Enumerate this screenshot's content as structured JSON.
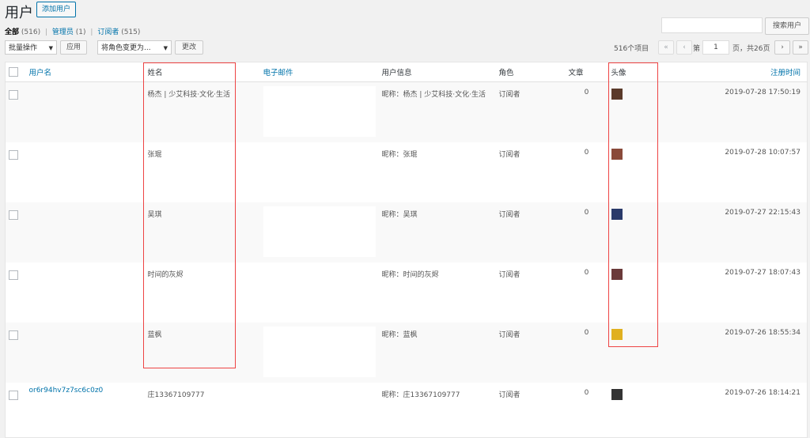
{
  "header": {
    "title": "用户",
    "add_button": "添加用户"
  },
  "search": {
    "button": "搜索用户",
    "value": ""
  },
  "filters": [
    {
      "label": "全部",
      "count": "(516)"
    },
    {
      "label": "管理员",
      "count": "(1)"
    },
    {
      "label": "订阅者",
      "count": "(515)"
    }
  ],
  "toolbar": {
    "bulk_select": "批量操作",
    "apply": "应用",
    "role_select": "将角色变更为...",
    "change": "更改"
  },
  "pagination": {
    "items": "516个项目",
    "first": "«",
    "prev": "‹",
    "prefix": "第",
    "current": "1",
    "suffix": "页，共26页",
    "next": "›",
    "last": "»"
  },
  "columns": {
    "username": "用户名",
    "name": "姓名",
    "email": "电子邮件",
    "info": "用户信息",
    "role": "角色",
    "posts": "文章",
    "avatar": "头像",
    "registered": "注册时间"
  },
  "rows": [
    {
      "username": "",
      "name": "杨杰 | 少艾科技·文化·生活",
      "email": "",
      "info": "昵称：杨杰 | 少艾科技·文化·生活",
      "role": "订阅者",
      "posts": "0",
      "avatar_color": "#5a3a2a",
      "registered": "2019-07-28 17:50:19"
    },
    {
      "username": "",
      "name": "张琨",
      "email": "",
      "info": "昵称：张琨",
      "role": "订阅者",
      "posts": "0",
      "avatar_color": "#8a4a3a",
      "registered": "2019-07-28 10:07:57"
    },
    {
      "username": "",
      "name": "吴琪",
      "email": "",
      "info": "昵称：吴琪",
      "role": "订阅者",
      "posts": "0",
      "avatar_color": "#2a3a6a",
      "registered": "2019-07-27 22:15:43"
    },
    {
      "username": "",
      "name": "时间的灰烬",
      "email": "",
      "info": "昵称：时间的灰烬",
      "role": "订阅者",
      "posts": "0",
      "avatar_color": "#6a3a3a",
      "registered": "2019-07-27 18:07:43"
    },
    {
      "username": "",
      "name": "蓝枫",
      "email": "",
      "info": "昵称：蓝枫",
      "role": "订阅者",
      "posts": "0",
      "avatar_color": "#e0b020",
      "registered": "2019-07-26 18:55:34"
    },
    {
      "username": "or6r94hv7z7sc6c0z0",
      "name": "庄13367109777",
      "email": "",
      "info": "昵称：庄13367109777",
      "role": "订阅者",
      "posts": "0",
      "avatar_color": "#333333",
      "registered": "2019-07-26 18:14:21"
    }
  ]
}
